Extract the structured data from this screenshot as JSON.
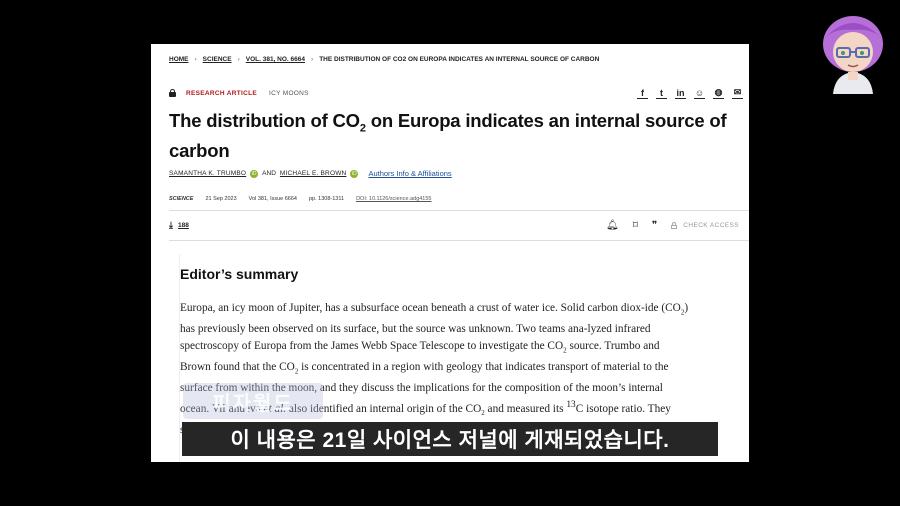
{
  "breadcrumb": {
    "home": "HOME",
    "science": "SCIENCE",
    "volume": "VOL. 381, NO. 6664",
    "current": "THE DISTRIBUTION OF CO2 ON EUROPA INDICATES AN INTERNAL SOURCE OF CARBON"
  },
  "article_type": "RESEARCH ARTICLE",
  "topic": "ICY MOONS",
  "social_icons": [
    "facebook-icon",
    "twitter-icon",
    "linkedin-icon",
    "reddit-icon",
    "wechat-icon",
    "email-icon"
  ],
  "title": {
    "part1": "The distribution of CO",
    "sub": "2",
    "part2": " on Europa indicates an internal source of carbon"
  },
  "authors": {
    "a1": "SAMANTHA K. TRUMBO",
    "and": "AND",
    "a2": "MICHAEL E. BROWN",
    "affiliations": "Authors Info & Affiliations"
  },
  "meta": {
    "journal": "SCIENCE",
    "date": "21 Sep 2023",
    "issue": "Vol 381, Issue 6664",
    "pages": "pp. 1308-1311",
    "doi": "DOI: 10.1126/science.adg4155"
  },
  "toolbar": {
    "downloads": "188",
    "check_access": "CHECK ACCESS"
  },
  "summary": {
    "heading": "Editor’s summary",
    "t1": "Europa, an icy moon of Jupiter, has a subsurface ocean beneath a crust of water ice. Solid carbon diox-ide (CO",
    "t2": ") has previously been observed on its surface, but the source was unknown. Two teams ana-lyzed infrared spectroscopy of Europa from the James Webb Space Telescope to investigate the CO",
    "t3": " source. Trumbo and Brown found that the CO",
    "t4": " is concentrated in a region with geology that indicates transport of material to the surface from within the moon, and they discuss the implications for the composition of the moon’s internal ocean. Villanueva ",
    "etal": "et al.",
    "t5": " also identified an internal origin of the CO",
    "t6": " and measured its ",
    "t6b": "C isotope ratio. They searched for plumes of volatile material breaching the",
    "sub2": "2"
  },
  "watermark": "피자월드",
  "caption": "이 내용은 21일 사이언스 저널에 게재되었습니다."
}
